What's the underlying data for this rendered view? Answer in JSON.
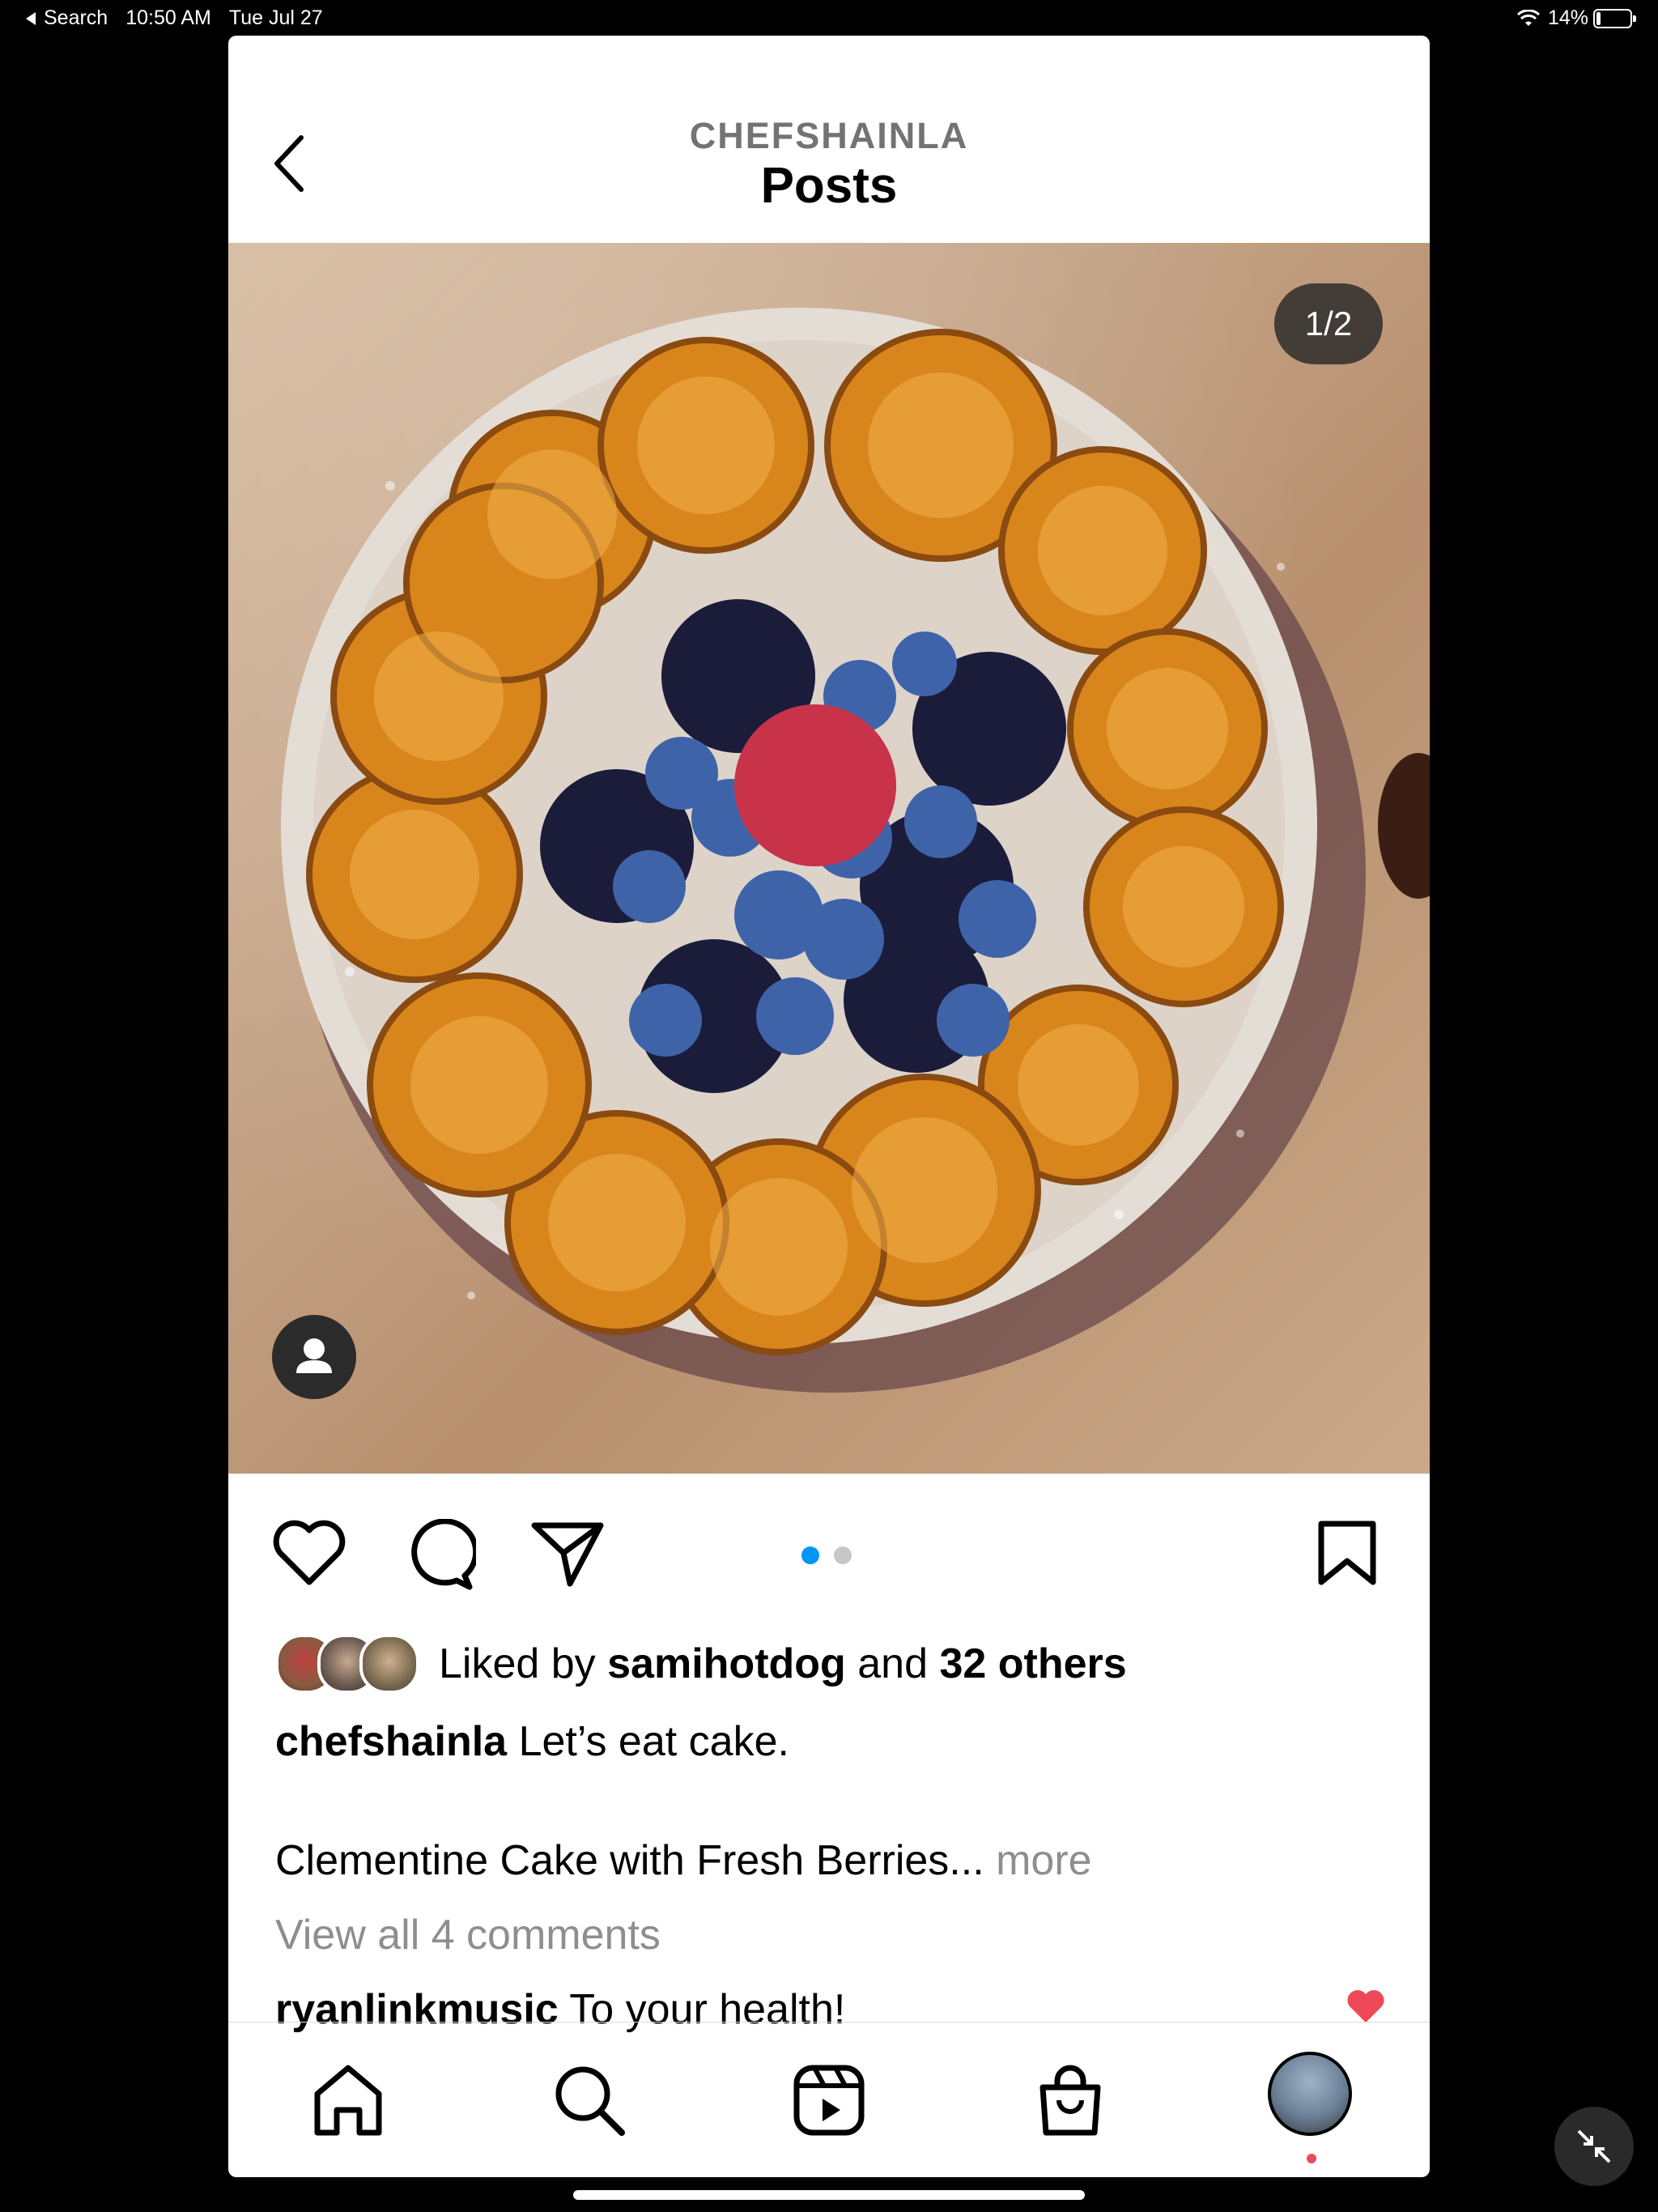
{
  "status_bar": {
    "back_app": "Search",
    "time": "10:50 AM",
    "date": "Tue Jul 27",
    "battery": "14%"
  },
  "header": {
    "username": "CHEFSHAINLA",
    "title": "Posts",
    "back_icon": "chevron-left-icon"
  },
  "post": {
    "image_counter": "1/2",
    "carousel": {
      "count": 2,
      "active_index": 0,
      "active_color": "#0095f6",
      "inactive_color": "#c7c7c7"
    },
    "actions": {
      "like_icon": "heart-icon",
      "comment_icon": "comment-icon",
      "share_icon": "send-icon",
      "save_icon": "bookmark-icon"
    },
    "likes": {
      "prefix": "Liked by",
      "user": "samihotdog",
      "joiner": "and",
      "others": "32 others"
    },
    "caption": {
      "username": "chefshainla",
      "text": "Let’s eat cake."
    },
    "caption_more": {
      "text": "Clementine Cake with Fresh Berries...",
      "more_label": "more"
    },
    "view_comments": "View all 4 comments",
    "comment": {
      "username": "ryanlinkmusic",
      "text": "To your health!",
      "liked_color": "#ed4956"
    }
  },
  "bottom_nav": {
    "items": [
      "home-icon",
      "search-icon",
      "reels-icon",
      "shop-icon",
      "profile-avatar"
    ]
  }
}
